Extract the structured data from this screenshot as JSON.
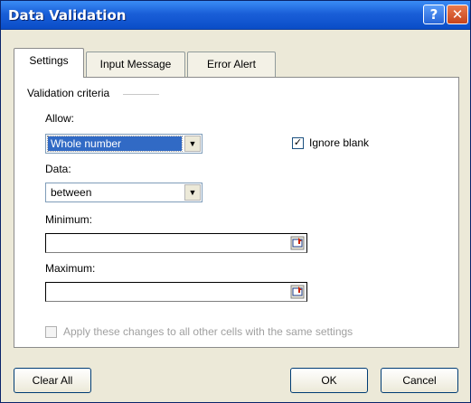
{
  "window": {
    "title": "Data Validation",
    "help_glyph": "?",
    "close_glyph": "✕"
  },
  "tabs": [
    {
      "label": "Settings",
      "active": true
    },
    {
      "label": "Input Message",
      "active": false
    },
    {
      "label": "Error Alert",
      "active": false
    }
  ],
  "criteria": {
    "group_title": "Validation criteria",
    "allow_label": "Allow:",
    "allow_value": "Whole number",
    "ignore_blank_label": "Ignore blank",
    "ignore_blank_checked": "✓",
    "data_label": "Data:",
    "data_value": "between",
    "minimum_label": "Minimum:",
    "minimum_value": "",
    "maximum_label": "Maximum:",
    "maximum_value": "",
    "apply_all_label": "Apply these changes to all other cells with the same settings"
  },
  "buttons": {
    "clear_all": "Clear All",
    "ok": "OK",
    "cancel": "Cancel"
  },
  "icons": {
    "dropdown": "chevron-down-icon",
    "range_select": "range-select-icon"
  },
  "colors": {
    "titlebar": "#0a4dc8",
    "selection": "#316ac5"
  }
}
